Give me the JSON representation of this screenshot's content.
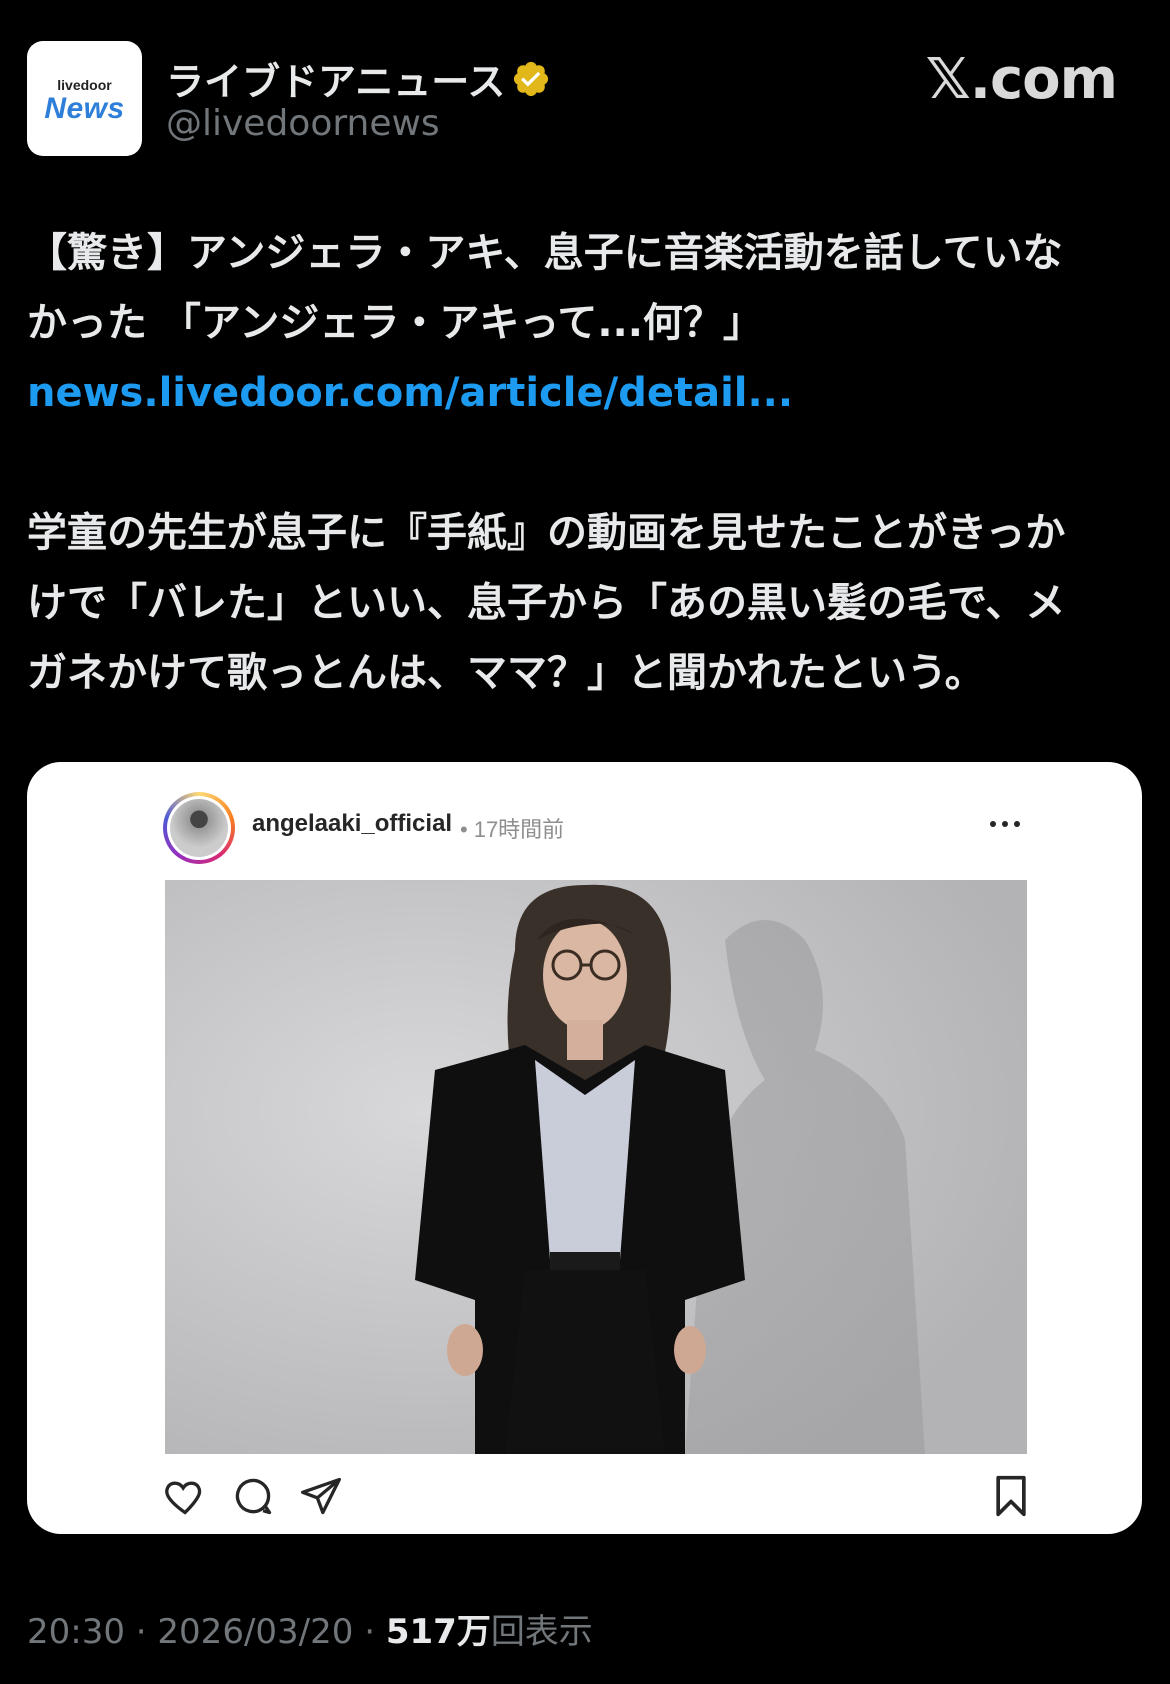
{
  "header": {
    "logo_top": "livedoor",
    "logo_main": "News",
    "display_name": "ライブドアニュース",
    "verified": true,
    "verified_color": "#e2b719",
    "handle": "@livedoornews",
    "site_mark": "𝕏.com"
  },
  "post": {
    "line1": "【驚き】アンジェラ・アキ、息子に音楽活動を話していな",
    "line2": "かった 「アンジェラ・アキって...何？」",
    "link": "news.livedoor.com/article/detail...",
    "para2_line1": "学童の先生が息子に『手紙』の動画を見せたことがきっか",
    "para2_line2": "けで「バレた」といい、息子から「あの黒い髪の毛で、メ",
    "para2_line3": "ガネかけて歌っとんは、ママ？」と聞かれたという。"
  },
  "embed": {
    "username": "angelaaki_official",
    "time": "17時間前",
    "actions": [
      "heart-icon",
      "comment-icon",
      "share-icon",
      "bookmark-icon"
    ]
  },
  "footer": {
    "time": "20:30",
    "date": "2026/03/20",
    "views_num": "517",
    "views_unit": "万",
    "views_label": "回表示",
    "sep": "·"
  },
  "colors": {
    "background": "#000000",
    "text": "#e7e9ea",
    "muted": "#71767b",
    "link": "#1d9bf0"
  }
}
